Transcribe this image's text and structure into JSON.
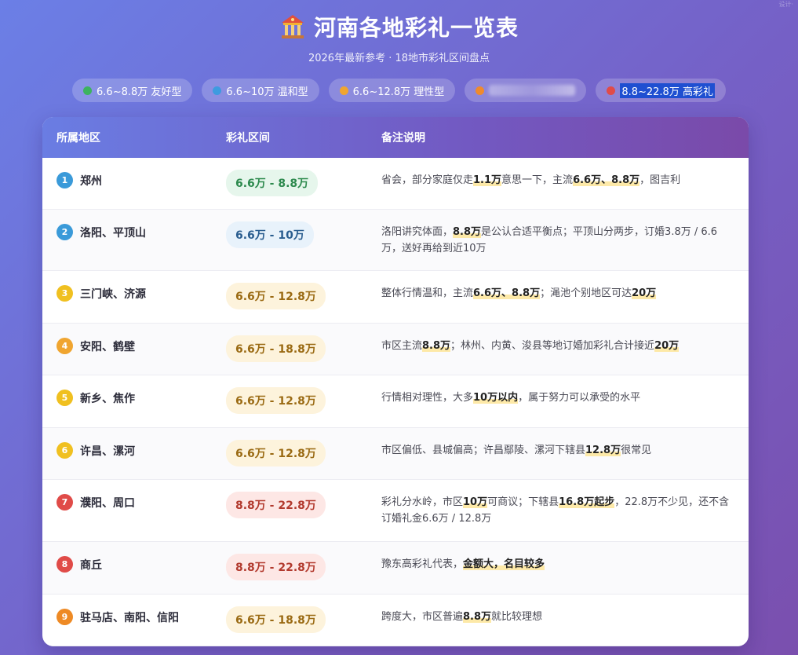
{
  "corner_mark": "设计·",
  "header": {
    "title": "河南各地彩礼一览表",
    "subtitle": "2026年最新参考 · 18地市彩礼区间盘点"
  },
  "legend": [
    {
      "color": "#3cb35f",
      "label": "6.6~8.8万 友好型",
      "blurred": false,
      "selected": false
    },
    {
      "color": "#3d9be0",
      "label": "6.6~10万 温和型",
      "blurred": false,
      "selected": false
    },
    {
      "color": "#f0a530",
      "label": "6.6~12.8万 理性型",
      "blurred": false,
      "selected": false
    },
    {
      "color": "#ef8a2d",
      "label": "",
      "blurred": true,
      "selected": false
    },
    {
      "color": "#e04b48",
      "label": "8.8~22.8万 高彩礼",
      "blurred": false,
      "selected": true
    }
  ],
  "table": {
    "headers": [
      "所属地区",
      "彩礼区间",
      "备注说明"
    ],
    "rows": [
      {
        "num": "1",
        "num_color": "#3a9ad9",
        "region": "郑州",
        "range": "6.6万 - 8.8万",
        "badge": "green",
        "note": [
          [
            "省会，部分家庭仅走",
            false
          ],
          [
            "1.1万",
            true
          ],
          [
            "意思一下，主流",
            false
          ],
          [
            "6.6万、8.8万",
            true
          ],
          [
            "，图吉利",
            false
          ]
        ]
      },
      {
        "num": "2",
        "num_color": "#3a9ad9",
        "region": "洛阳、平顶山",
        "range": "6.6万 - 10万",
        "badge": "blue",
        "note": [
          [
            "洛阳讲究体面，",
            false
          ],
          [
            "8.8万",
            true
          ],
          [
            "是公认合适平衡点；平顶山分两步，订婚3.8万 / 6.6万，送好再给到近10万",
            false
          ]
        ]
      },
      {
        "num": "3",
        "num_color": "#f0c020",
        "region": "三门峡、济源",
        "range": "6.6万 - 12.8万",
        "badge": "yellow",
        "note": [
          [
            "整体行情温和，主流",
            false
          ],
          [
            "6.6万、8.8万",
            true
          ],
          [
            "；渑池个别地区可达",
            false
          ],
          [
            "20万",
            true
          ]
        ]
      },
      {
        "num": "4",
        "num_color": "#f0a530",
        "region": "安阳、鹤壁",
        "range": "6.6万 - 18.8万",
        "badge": "yellow",
        "note": [
          [
            "市区主流",
            false
          ],
          [
            "8.8万",
            true
          ],
          [
            "；林州、内黄、浚县等地订婚加彩礼合计接近",
            false
          ],
          [
            "20万",
            true
          ]
        ]
      },
      {
        "num": "5",
        "num_color": "#f0c020",
        "region": "新乡、焦作",
        "range": "6.6万 - 12.8万",
        "badge": "yellow",
        "note": [
          [
            "行情相对理性，大多",
            false
          ],
          [
            "10万以内",
            true
          ],
          [
            "，属于努力可以承受的水平",
            false
          ]
        ]
      },
      {
        "num": "6",
        "num_color": "#f0c020",
        "region": "许昌、漯河",
        "range": "6.6万 - 12.8万",
        "badge": "yellow",
        "note": [
          [
            "市区偏低、县城偏高；许昌鄢陵、漯河下辖县",
            false
          ],
          [
            "12.8万",
            true
          ],
          [
            "很常见",
            false
          ]
        ]
      },
      {
        "num": "7",
        "num_color": "#e04b48",
        "region": "濮阳、周口",
        "range": "8.8万 - 22.8万",
        "badge": "red",
        "note": [
          [
            "彩礼分水岭，市区",
            false
          ],
          [
            "10万",
            true
          ],
          [
            "可商议；下辖县",
            false
          ],
          [
            "16.8万起步",
            true
          ],
          [
            "，22.8万不少见，还不含订婚礼金6.6万 / 12.8万",
            false
          ]
        ]
      },
      {
        "num": "8",
        "num_color": "#e04b48",
        "region": "商丘",
        "range": "8.8万 - 22.8万",
        "badge": "red",
        "note": [
          [
            "豫东高彩礼代表，",
            false
          ],
          [
            "金额大，名目较多",
            true
          ]
        ]
      },
      {
        "num": "9",
        "num_color": "#ee8a25",
        "region": "驻马店、南阳、信阳",
        "range": "6.6万 - 18.8万",
        "badge": "yellow",
        "note": [
          [
            "跨度大，市区普遍",
            false
          ],
          [
            "8.8万",
            true
          ],
          [
            "就比较理想",
            false
          ]
        ]
      }
    ]
  }
}
